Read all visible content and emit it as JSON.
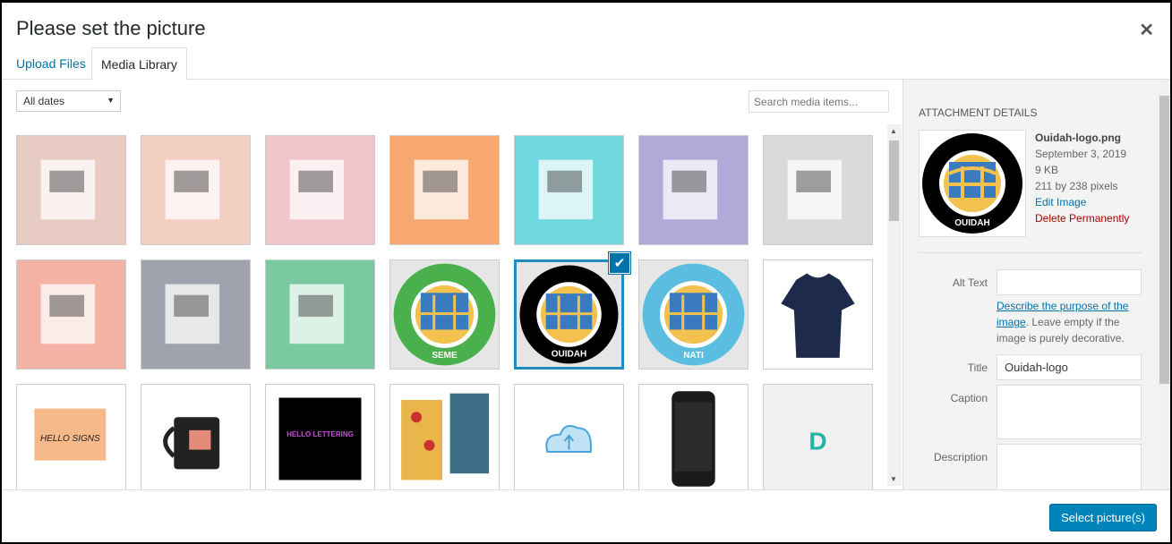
{
  "modal": {
    "title": "Please set the picture",
    "close_glyph": "✕"
  },
  "tabs": [
    {
      "label": "Upload Files"
    },
    {
      "label": "Media Library"
    }
  ],
  "toolbar": {
    "date_filter": "All dates",
    "search_placeholder": "Search media items..."
  },
  "grid": {
    "items": [
      {
        "label": "",
        "color": "#e8ccc3",
        "kind": "photo"
      },
      {
        "label": "",
        "color": "#f3cfc2",
        "kind": "photo"
      },
      {
        "label": "",
        "color": "#f2c4cc",
        "kind": "photo"
      },
      {
        "label": "",
        "color": "#f7a871",
        "kind": "photo"
      },
      {
        "label": "",
        "color": "#6fd7de",
        "kind": "photo"
      },
      {
        "label": "",
        "color": "#b3a9d9",
        "kind": "photo"
      },
      {
        "label": "",
        "color": "#d9d9d9",
        "kind": "photo"
      },
      {
        "label": "",
        "color": "#f4b2a4",
        "kind": "photo"
      },
      {
        "label": "",
        "color": "#9ea3ad",
        "kind": "photo"
      },
      {
        "label": "",
        "color": "#7ac9a0",
        "kind": "photo"
      },
      {
        "label": "SEME",
        "color": "#4ab04c",
        "kind": "logo"
      },
      {
        "label": "OUIDAH",
        "color": "#000000",
        "kind": "logo",
        "selected": true
      },
      {
        "label": "NATI",
        "color": "#5bbee0",
        "kind": "logo"
      },
      {
        "label": "",
        "color": "#ffffff",
        "kind": "tshirt"
      },
      {
        "label": "HELLO SIGNS",
        "color": "#ffffff",
        "kind": "signs"
      },
      {
        "label": "",
        "color": "#ffffff",
        "kind": "mug"
      },
      {
        "label": "HELLO LETTERING",
        "color": "#ffffff",
        "kind": "lettering"
      },
      {
        "label": "",
        "color": "#ffffff",
        "kind": "cards"
      },
      {
        "label": "",
        "color": "#ffffff",
        "kind": "cloud"
      },
      {
        "label": "",
        "color": "#ffffff",
        "kind": "phone"
      },
      {
        "label": "D",
        "color": "#f0f0f0",
        "kind": "dlogo"
      }
    ]
  },
  "sidebar": {
    "heading": "Attachment Details",
    "filename": "Ouidah-logo.png",
    "date": "September 3, 2019",
    "size": "9 KB",
    "dimensions": "211 by 238 pixels",
    "edit_link": "Edit Image",
    "delete_link": "Delete Permanently",
    "alt_label": "Alt Text",
    "alt_value": "",
    "alt_help_link": "Describe the purpose of the image",
    "alt_help_text": ". Leave empty if the image is purely decorative.",
    "title_label": "Title",
    "title_value": "Ouidah-logo",
    "caption_label": "Caption",
    "caption_value": "",
    "description_label": "Description",
    "description_value": "",
    "thumb_label": "OUIDAH"
  },
  "footer": {
    "select_button": "Select picture(s)"
  },
  "colors": {
    "accent": "#0085ba",
    "selection": "#1e8cbe",
    "link": "#0073aa",
    "delete": "#aa0000"
  }
}
